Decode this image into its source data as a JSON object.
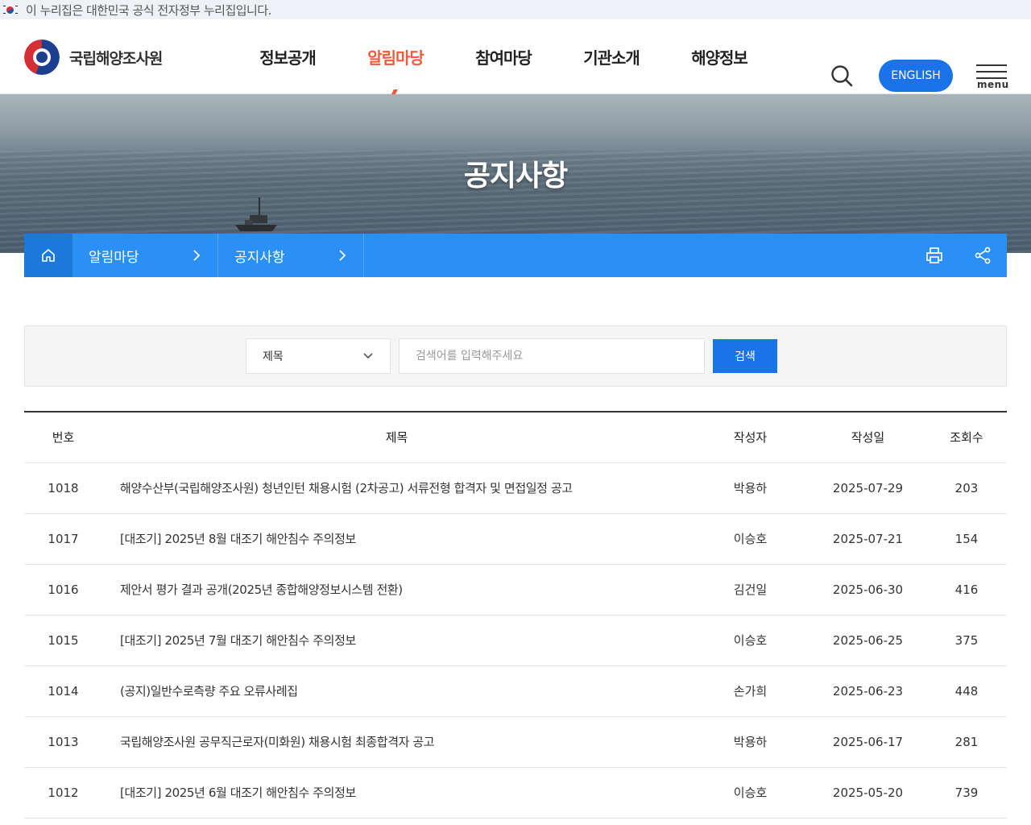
{
  "gov_banner": {
    "text": "이 누리집은 대한민국 공식 전자정부 누리집입니다."
  },
  "header": {
    "logo_text": "국립해양조사원",
    "nav": [
      {
        "label": "정보공개",
        "active": false
      },
      {
        "label": "알림마당",
        "active": true
      },
      {
        "label": "참여마당",
        "active": false
      },
      {
        "label": "기관소개",
        "active": false
      },
      {
        "label": "해양정보",
        "active": false
      }
    ],
    "english_label": "ENGLISH",
    "menu_label": "menu"
  },
  "hero": {
    "title": "공지사항"
  },
  "breadcrumb": {
    "items": [
      "알림마당",
      "공지사항"
    ]
  },
  "search": {
    "field_selected": "제목",
    "placeholder": "검색어를 입력해주세요",
    "button_label": "검색"
  },
  "table": {
    "headers": [
      "번호",
      "제목",
      "작성자",
      "작성일",
      "조회수"
    ],
    "rows": [
      {
        "no": "1018",
        "title": "해양수산부(국립해양조사원) 청년인턴 채용시험 (2차공고) 서류전형 합격자 및 면접일정 공고",
        "author": "박용하",
        "date": "2025-07-29",
        "views": "203"
      },
      {
        "no": "1017",
        "title": "[대조기] 2025년 8월 대조기 해안침수 주의정보",
        "author": "이승호",
        "date": "2025-07-21",
        "views": "154"
      },
      {
        "no": "1016",
        "title": "제안서 평가 결과 공개(2025년 종합해양정보시스템 전환)",
        "author": "김건일",
        "date": "2025-06-30",
        "views": "416"
      },
      {
        "no": "1015",
        "title": "[대조기] 2025년 7월 대조기 해안침수 주의정보",
        "author": "이승호",
        "date": "2025-06-25",
        "views": "375"
      },
      {
        "no": "1014",
        "title": "(공지)일반수로측량 주요 오류사례집",
        "author": "손가희",
        "date": "2025-06-23",
        "views": "448"
      },
      {
        "no": "1013",
        "title": "국립해양조사원 공무직근로자(미화원) 채용시험 최종합격자 공고",
        "author": "박용하",
        "date": "2025-06-17",
        "views": "281"
      },
      {
        "no": "1012",
        "title": "[대조기] 2025년 6월 대조기 해안침수 주의정보",
        "author": "이승호",
        "date": "2025-05-20",
        "views": "739"
      }
    ]
  },
  "colors": {
    "accent": "#f25a3c",
    "primary": "#1a73e8",
    "breadcrumb_bar": "#2b90f5"
  }
}
